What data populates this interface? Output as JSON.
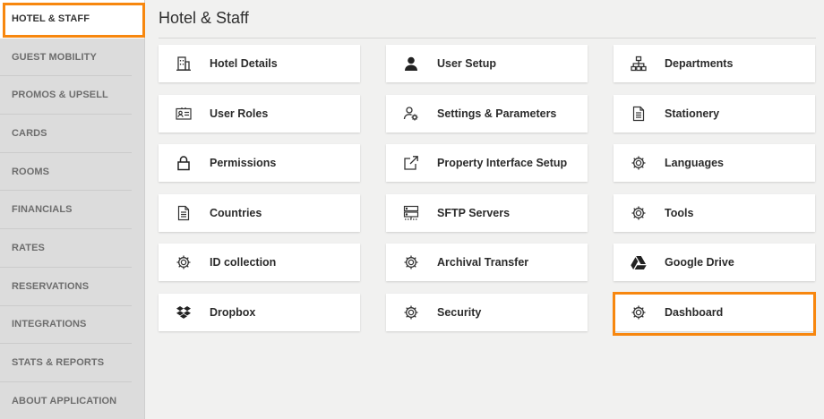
{
  "sidebar": {
    "items": [
      {
        "label": "HOTEL & STAFF",
        "active": true
      },
      {
        "label": "GUEST MOBILITY"
      },
      {
        "label": "PROMOS & UPSELL"
      },
      {
        "label": "CARDS"
      },
      {
        "label": "ROOMS"
      },
      {
        "label": "FINANCIALS"
      },
      {
        "label": "RATES"
      },
      {
        "label": "RESERVATIONS"
      },
      {
        "label": "INTEGRATIONS"
      },
      {
        "label": "STATS & REPORTS"
      },
      {
        "label": "ABOUT APPLICATION"
      }
    ]
  },
  "main": {
    "title": "Hotel & Staff",
    "cards": [
      {
        "label": "Hotel Details",
        "icon": "building-icon"
      },
      {
        "label": "User Setup",
        "icon": "user-icon"
      },
      {
        "label": "Departments",
        "icon": "org-chart-icon"
      },
      {
        "label": "User Roles",
        "icon": "id-card-icon"
      },
      {
        "label": "Settings & Parameters",
        "icon": "user-settings-icon"
      },
      {
        "label": "Stationery",
        "icon": "document-icon"
      },
      {
        "label": "Permissions",
        "icon": "lock-icon"
      },
      {
        "label": "Property Interface Setup",
        "icon": "external-link-icon"
      },
      {
        "label": "Languages",
        "icon": "gear-icon"
      },
      {
        "label": "Countries",
        "icon": "document-icon"
      },
      {
        "label": "SFTP Servers",
        "icon": "server-icon"
      },
      {
        "label": "Tools",
        "icon": "gear-icon"
      },
      {
        "label": "ID collection",
        "icon": "gear-icon"
      },
      {
        "label": "Archival Transfer",
        "icon": "gear-icon"
      },
      {
        "label": "Google Drive",
        "icon": "google-drive-icon"
      },
      {
        "label": "Dropbox",
        "icon": "dropbox-icon"
      },
      {
        "label": "Security",
        "icon": "gear-icon"
      },
      {
        "label": "Dashboard",
        "icon": "gear-icon",
        "highlighted": true
      }
    ]
  },
  "colors": {
    "highlight": "#f7870f",
    "sidebar_bg": "#dcdcdc",
    "page_bg": "#f1f1f0",
    "card_bg": "#ffffff"
  }
}
